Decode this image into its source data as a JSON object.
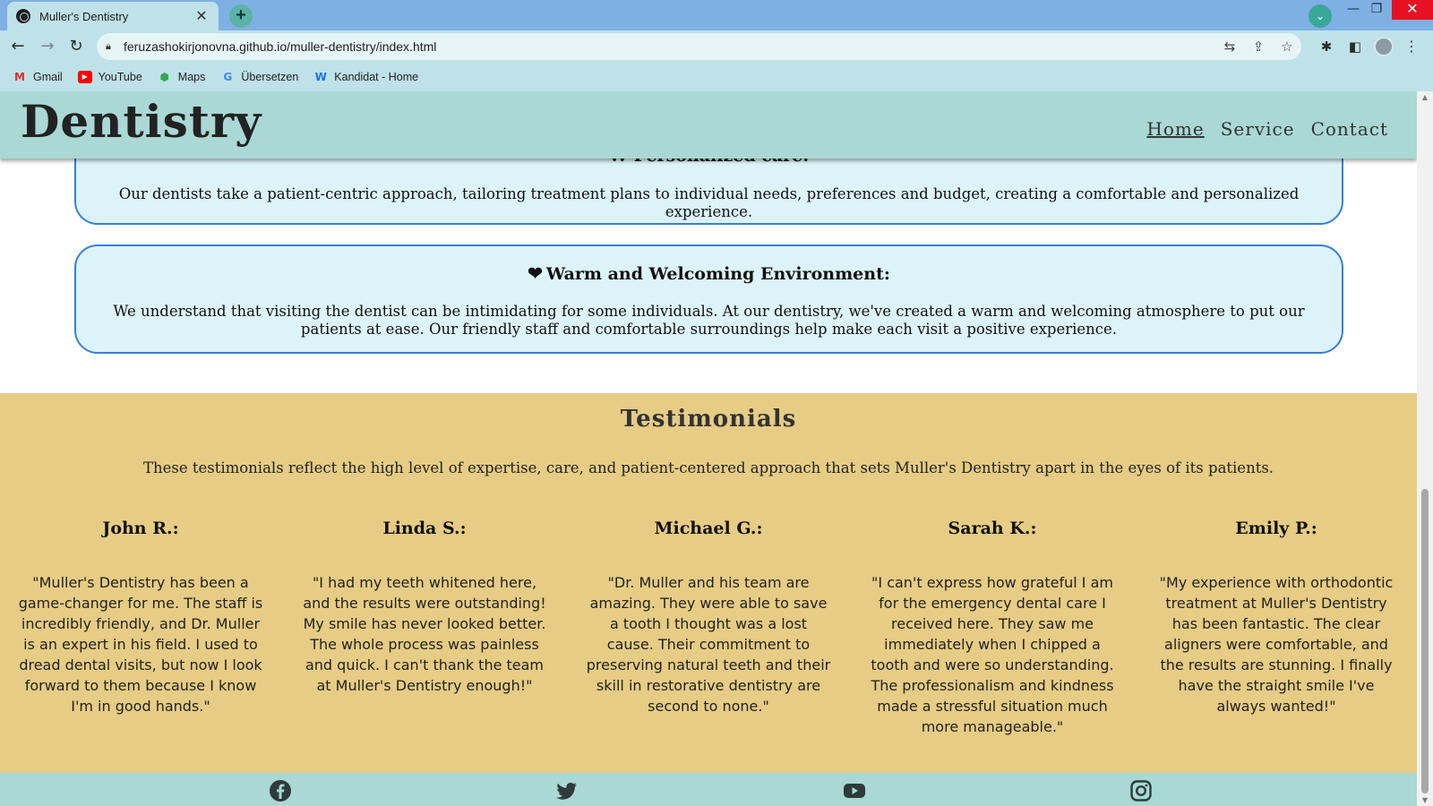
{
  "browser": {
    "tab_title": "Muller's Dentistry",
    "tab_close": "✕",
    "new_tab": "+",
    "url": "feruzashokirjonovna.github.io/muller-dentistry/index.html",
    "bookmarks": [
      {
        "label": "Gmail",
        "icon": "gmail-icon",
        "color": "#d93025"
      },
      {
        "label": "YouTube",
        "icon": "youtube-icon",
        "color": "#ff0000"
      },
      {
        "label": "Maps",
        "icon": "maps-icon",
        "color": "#34a853"
      },
      {
        "label": "Übersetzen",
        "icon": "translate-icon",
        "color": "#4285f4"
      },
      {
        "label": "Kandidat - Home",
        "icon": "kandidat-icon",
        "color": "#1a73e8"
      }
    ]
  },
  "site": {
    "brand": "Dentistry",
    "nav": [
      "Home",
      "Service",
      "Contact"
    ]
  },
  "features": [
    {
      "title": "W Personalized care:",
      "text": "Our dentists take a patient-centric approach, tailoring treatment plans to individual needs, preferences and budget, creating a comfortable and personalized experience."
    },
    {
      "icon": "heart-icon",
      "title": "Warm and Welcoming Environment:",
      "text": "We understand that visiting the dentist can be intimidating for some individuals. At our dentistry, we've created a warm and welcoming atmosphere to put our patients at ease. Our friendly staff and comfortable surroundings help make each visit a positive experience."
    }
  ],
  "testimonials": {
    "heading": "Testimonials",
    "intro": "These testimonials reflect the high level of expertise, care, and patient-centered approach that sets Muller's Dentistry apart in the eyes of its patients.",
    "items": [
      {
        "name": "John R.:",
        "quote": "\"Muller's Dentistry has been a game-changer for me. The staff is incredibly friendly, and Dr. Muller is an expert in his field. I used to dread dental visits, but now I look forward to them because I know I'm in good hands.\""
      },
      {
        "name": "Linda S.:",
        "quote": "\"I had my teeth whitened here, and the results were outstanding! My smile has never looked better. The whole process was painless and quick. I can't thank the team at Muller's Dentistry enough!\""
      },
      {
        "name": "Michael G.:",
        "quote": "\"Dr. Muller and his team are amazing. They were able to save a tooth I thought was a lost cause. Their commitment to preserving natural teeth and their skill in restorative dentistry are second to none.\""
      },
      {
        "name": "Sarah K.:",
        "quote": "\"I can't express how grateful I am for the emergency dental care I received here. They saw me immediately when I chipped a tooth and were so understanding. The professionalism and kindness made a stressful situation much more manageable.\""
      },
      {
        "name": "Emily P.:",
        "quote": "\"My experience with orthodontic treatment at Muller's Dentistry has been fantastic. The clear aligners were comfortable, and the results are stunning. I finally have the straight smile I've always wanted!\""
      }
    ]
  },
  "footer": {
    "social": [
      "facebook-icon",
      "twitter-icon",
      "youtube-icon",
      "instagram-icon"
    ]
  },
  "colors": {
    "header_bg": "#a9d8d5",
    "card_bg": "#dcf3f9",
    "card_border": "#3a7fd6",
    "testimonials_bg": "#e6cc84"
  }
}
